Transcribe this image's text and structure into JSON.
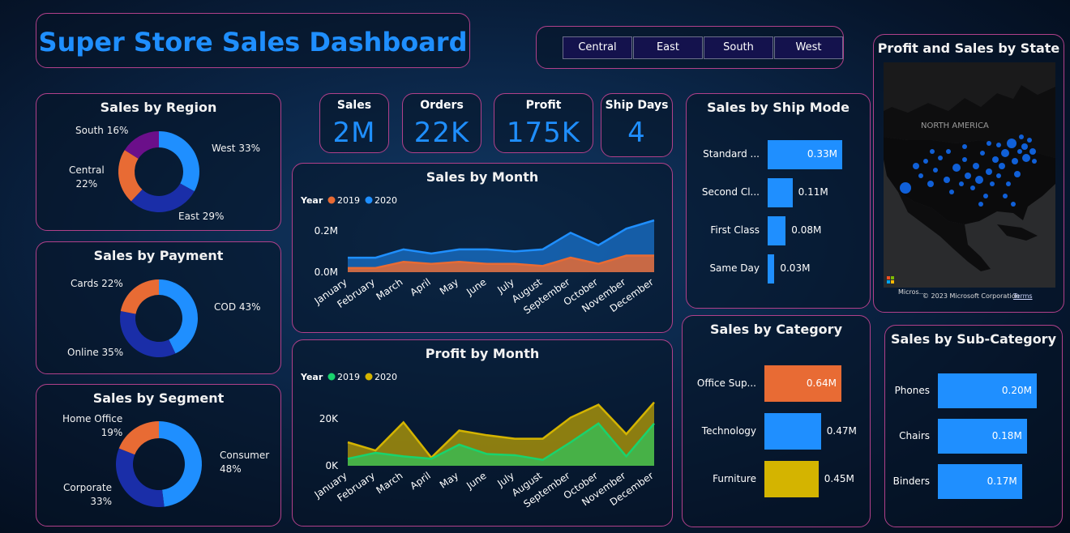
{
  "title": "Super Store Sales Dashboard",
  "region_buttons": [
    "Central",
    "East",
    "South",
    "West"
  ],
  "kpis": [
    {
      "title": "Sales",
      "value": "2M"
    },
    {
      "title": "Orders",
      "value": "22K"
    },
    {
      "title": "Profit",
      "value": "175K"
    },
    {
      "title": "Ship Days",
      "value": "4"
    }
  ],
  "colors": {
    "blue": "#1f8fff",
    "orange": "#e86b34",
    "navy": "#1a2ea8",
    "purple": "#6b0f8a",
    "gold": "#d4b400",
    "green": "#19d36d"
  },
  "map": {
    "title": "Profit and Sales by State",
    "region_label": "NORTH AMERICA",
    "attribution": "© 2023 Microsoft Corporation",
    "terms": "Terms",
    "logo_text": "Micros..."
  },
  "chart_data": [
    {
      "id": "sales_by_region",
      "type": "pie",
      "title": "Sales by Region",
      "labels": [
        "West",
        "East",
        "Central",
        "South"
      ],
      "values": [
        33,
        29,
        22,
        16
      ],
      "display_labels": [
        "West 33%",
        "East 29%",
        "Central 22%",
        "South 16%"
      ]
    },
    {
      "id": "sales_by_payment",
      "type": "pie",
      "title": "Sales by Payment",
      "labels": [
        "COD",
        "Online",
        "Cards"
      ],
      "values": [
        43,
        35,
        22
      ],
      "display_labels": [
        "COD 43%",
        "Online 35%",
        "Cards 22%"
      ]
    },
    {
      "id": "sales_by_segment",
      "type": "pie",
      "title": "Sales by Segment",
      "labels": [
        "Consumer",
        "Corporate",
        "Home Office"
      ],
      "values": [
        48,
        33,
        19
      ],
      "display_labels": [
        "Consumer 48%",
        "Corporate 33%",
        "Home Office 19%"
      ]
    },
    {
      "id": "sales_by_month",
      "type": "area",
      "title": "Sales by Month",
      "legend_title": "Year",
      "categories": [
        "January",
        "February",
        "March",
        "April",
        "May",
        "June",
        "July",
        "August",
        "September",
        "October",
        "November",
        "December"
      ],
      "yticks": [
        "0.0M",
        "0.2M"
      ],
      "ylim": [
        0,
        0.25
      ],
      "series": [
        {
          "name": "2019",
          "values": [
            0.02,
            0.02,
            0.05,
            0.04,
            0.05,
            0.04,
            0.04,
            0.03,
            0.07,
            0.04,
            0.08,
            0.08
          ]
        },
        {
          "name": "2020",
          "values": [
            0.07,
            0.07,
            0.11,
            0.09,
            0.11,
            0.11,
            0.1,
            0.11,
            0.19,
            0.13,
            0.21,
            0.25
          ]
        }
      ]
    },
    {
      "id": "profit_by_month",
      "type": "area",
      "title": "Profit by Month",
      "legend_title": "Year",
      "categories": [
        "January",
        "February",
        "March",
        "April",
        "May",
        "June",
        "July",
        "August",
        "September",
        "October",
        "November",
        "December"
      ],
      "yticks": [
        "0K",
        "20K"
      ],
      "ylim": [
        0,
        30000
      ],
      "series": [
        {
          "name": "2019",
          "values": [
            3000,
            5500,
            4000,
            3000,
            9000,
            5000,
            4500,
            2500,
            10000,
            18000,
            4000,
            18000
          ]
        },
        {
          "name": "2020",
          "values": [
            10000,
            6500,
            18500,
            3500,
            15000,
            13000,
            11500,
            11500,
            20500,
            26000,
            13500,
            27000
          ]
        }
      ]
    },
    {
      "id": "sales_by_ship_mode",
      "type": "bar",
      "title": "Sales by Ship Mode",
      "categories": [
        "Standard ...",
        "Second Cl...",
        "First Class",
        "Same Day"
      ],
      "values": [
        0.33,
        0.11,
        0.08,
        0.03
      ],
      "value_labels": [
        "0.33M",
        "0.11M",
        "0.08M",
        "0.03M"
      ]
    },
    {
      "id": "sales_by_category",
      "type": "bar",
      "title": "Sales by Category",
      "categories": [
        "Office Sup...",
        "Technology",
        "Furniture"
      ],
      "values": [
        0.64,
        0.47,
        0.45
      ],
      "value_labels": [
        "0.64M",
        "0.47M",
        "0.45M"
      ]
    },
    {
      "id": "sales_by_sub_category",
      "type": "bar",
      "title": "Sales by Sub-Category",
      "categories": [
        "Phones",
        "Chairs",
        "Binders"
      ],
      "values": [
        0.2,
        0.18,
        0.17
      ],
      "value_labels": [
        "0.20M",
        "0.18M",
        "0.17M"
      ]
    }
  ]
}
